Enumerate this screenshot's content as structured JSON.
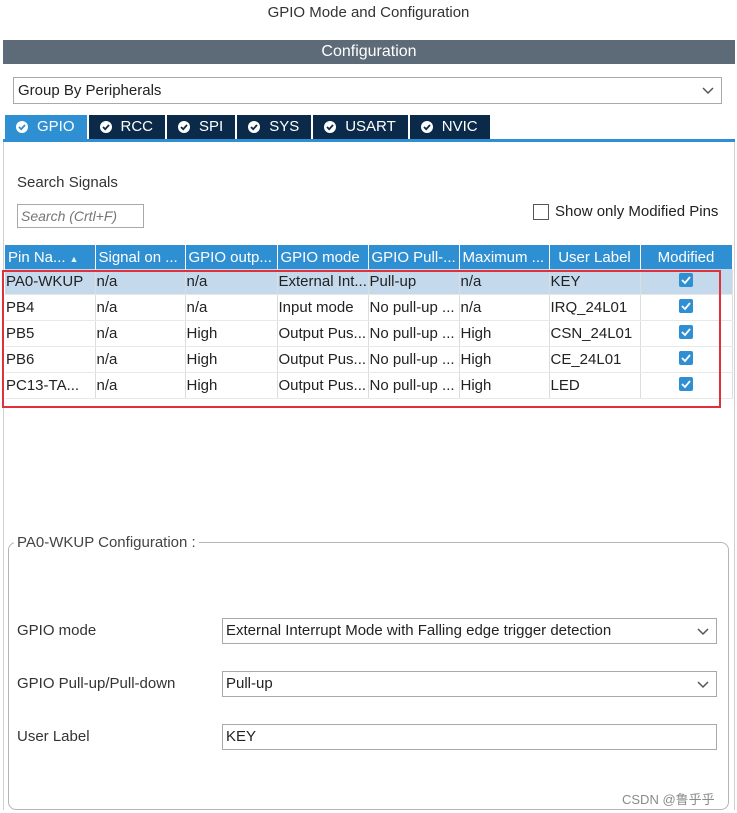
{
  "title": "GPIO Mode and Configuration",
  "configuration_header": "Configuration",
  "group_select": {
    "value": "Group By Peripherals"
  },
  "tabs": [
    {
      "label": "GPIO",
      "active": true
    },
    {
      "label": "RCC"
    },
    {
      "label": "SPI"
    },
    {
      "label": "SYS"
    },
    {
      "label": "USART"
    },
    {
      "label": "NVIC"
    }
  ],
  "search": {
    "label": "Search Signals",
    "placeholder": "Search (Crtl+F)"
  },
  "show_modified": {
    "label": "Show only Modified Pins",
    "checked": false
  },
  "table": {
    "columns": [
      "Pin Na...",
      "Signal on ...",
      "GPIO outp...",
      "GPIO mode",
      "GPIO Pull-...",
      "Maximum ...",
      "User Label",
      "Modified"
    ],
    "rows": [
      [
        "PA0-WKUP",
        "n/a",
        "n/a",
        "External Int...",
        "Pull-up",
        "n/a",
        "KEY"
      ],
      [
        "PB4",
        "n/a",
        "n/a",
        "Input mode",
        "No pull-up ...",
        "n/a",
        "IRQ_24L01"
      ],
      [
        "PB5",
        "n/a",
        "High",
        "Output Pus...",
        "No pull-up ...",
        "High",
        "CSN_24L01"
      ],
      [
        "PB6",
        "n/a",
        "High",
        "Output Pus...",
        "No pull-up ...",
        "High",
        "CE_24L01"
      ],
      [
        "PC13-TA...",
        "n/a",
        "High",
        "Output Pus...",
        "No pull-up ...",
        "High",
        "LED"
      ]
    ]
  },
  "pin_config": {
    "legend": "PA0-WKUP Configuration :",
    "gpio_mode_label": "GPIO mode",
    "gpio_mode_value": "External Interrupt Mode with Falling edge trigger detection",
    "pull_label": "GPIO Pull-up/Pull-down",
    "pull_value": "Pull-up",
    "user_label_label": "User Label",
    "user_label_value": "KEY"
  },
  "watermark": "CSDN @鲁乎乎",
  "colors": {
    "accent": "#2f8fd3",
    "tab_dark": "#0b2a4a",
    "header_gray": "#5d6a78",
    "highlight": "#e0303a",
    "selected_row": "#c5d9ec"
  }
}
